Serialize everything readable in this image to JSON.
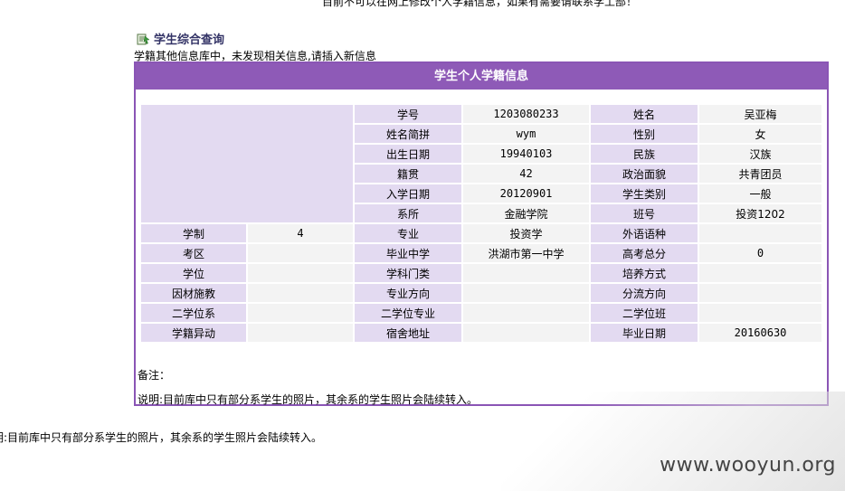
{
  "top_notice": "目前不可以在网上修改个人学籍信息，如果有需要请联系学工部！",
  "section_title": "学生综合查询",
  "db_notice": "学籍其他信息库中，未发现相关信息,请插入新信息",
  "panel_title": "学生个人学籍信息",
  "fields": {
    "student_id": {
      "label": "学号",
      "value": "1203080233"
    },
    "name": {
      "label": "姓名",
      "value": "吴亚梅"
    },
    "name_abbr": {
      "label": "姓名简拼",
      "value": "wym"
    },
    "gender": {
      "label": "性别",
      "value": "女"
    },
    "birth_date": {
      "label": "出生日期",
      "value": "19940103"
    },
    "ethnicity": {
      "label": "民族",
      "value": "汉族"
    },
    "native_place": {
      "label": "籍贯",
      "value": "42"
    },
    "political_status": {
      "label": "政治面貌",
      "value": "共青团员"
    },
    "enroll_date": {
      "label": "入学日期",
      "value": "20120901"
    },
    "student_type": {
      "label": "学生类别",
      "value": "一般"
    },
    "department": {
      "label": "系所",
      "value": "金融学院"
    },
    "class_no": {
      "label": "班号",
      "value": "投资1202"
    },
    "duration": {
      "label": "学制",
      "value": "4"
    },
    "major": {
      "label": "专业",
      "value": "投资学"
    },
    "foreign_lang": {
      "label": "外语语种",
      "value": ""
    },
    "exam_area": {
      "label": "考区",
      "value": ""
    },
    "graduated_school": {
      "label": "毕业中学",
      "value": "洪湖市第一中学"
    },
    "gaokao_total": {
      "label": "高考总分",
      "value": "0"
    },
    "degree": {
      "label": "学位",
      "value": ""
    },
    "subject_category": {
      "label": "学科门类",
      "value": ""
    },
    "training_mode": {
      "label": "培养方式",
      "value": ""
    },
    "tailored": {
      "label": "因材施教",
      "value": ""
    },
    "major_direction": {
      "label": "专业方向",
      "value": ""
    },
    "stream_direction": {
      "label": "分流方向",
      "value": ""
    },
    "second_degree_dept": {
      "label": "二学位系",
      "value": ""
    },
    "second_degree_major": {
      "label": "二学位专业",
      "value": ""
    },
    "second_degree_class": {
      "label": "二学位班",
      "value": ""
    },
    "status_change": {
      "label": "学籍异动",
      "value": ""
    },
    "dorm_address": {
      "label": "宿舍地址",
      "value": ""
    },
    "graduation_date": {
      "label": "毕业日期",
      "value": "20160630"
    }
  },
  "remark_label": "备注：",
  "explain_text": "说明:目前库中只有部分系学生的照片，其余系的学生照片会陆续转入。",
  "footer_note": "明:目前库中只有部分系学生的照片，其余系的学生照片会陆续转入。",
  "watermark": "www.wooyun.org",
  "colors": {
    "accent": "#8e5ab7",
    "label_bg": "#e3daf1",
    "value_bg": "#f3f3f3"
  }
}
